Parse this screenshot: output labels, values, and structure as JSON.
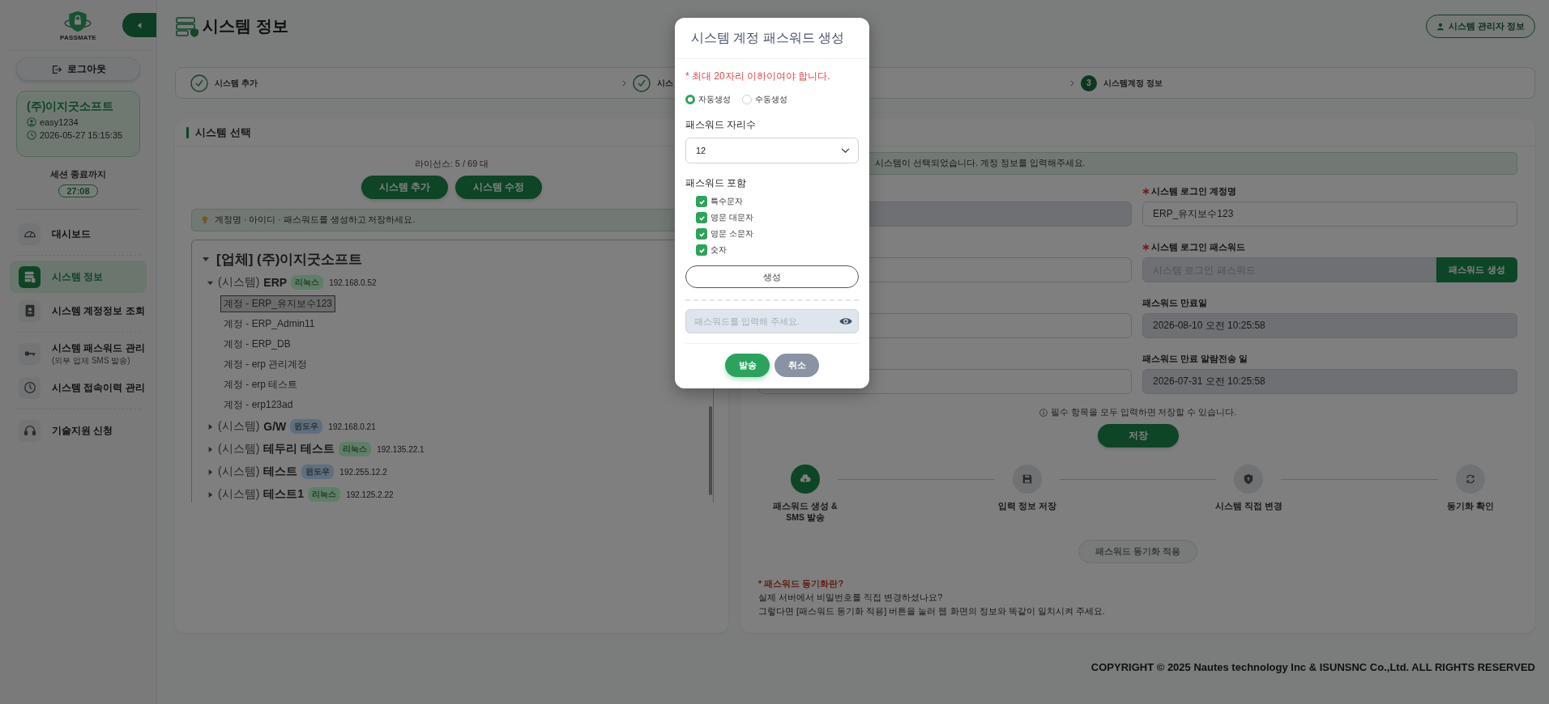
{
  "sidebar": {
    "logo_text": "PASSMATE",
    "logout": "로그아웃",
    "user": {
      "company": "(주)이지굿소프트",
      "id": "easy1234",
      "time": "2026-05-27 15:15:35"
    },
    "session": {
      "label": "세션 종료까지",
      "remaining": "27:08"
    },
    "nav_groups": [
      {
        "items": [
          {
            "label": "대시보드",
            "selected": false
          }
        ]
      },
      {
        "items": [
          {
            "label": "시스템 정보",
            "selected": true
          },
          {
            "label": "시스템 계정정보 조회",
            "selected": false
          }
        ]
      },
      {
        "items": [
          {
            "label": "시스템 패스워드 관리",
            "sub": "(외부 업체 SMS 발송)",
            "selected": false
          },
          {
            "label": "시스템 접속이력 관리",
            "selected": false
          }
        ]
      },
      {
        "items": [
          {
            "label": "기술지원 신청",
            "selected": false
          }
        ]
      }
    ]
  },
  "header": {
    "title": "시스템 정보",
    "admin_button": "시스템 관리자 정보"
  },
  "stepper": [
    {
      "label": "시스템 추가",
      "kind": "done"
    },
    {
      "label": "시스",
      "kind": "done"
    },
    {
      "label": "시스템계정 정보",
      "kind": "current",
      "number": "3"
    }
  ],
  "system_panel": {
    "title": "시스템 선택",
    "license": "라이선스: 5 / 69 대",
    "buttons": [
      "시스템 추가",
      "시스템 수정"
    ],
    "hint": "계정명 · 아이디 · 패스워드를 생성하고 저장하세요.",
    "tree": {
      "label": "[업체] (주)이지굿소프트",
      "expanded": true,
      "children": [
        {
          "prefix": "(시스템)",
          "name": "ERP",
          "tag": {
            "label": "리눅스",
            "color": "#5e7f66"
          },
          "ip": "192.168.0.52",
          "expanded": true,
          "children": [
            {
              "label": "계정 - ERP_유지보수123",
              "selected": true
            },
            {
              "label": "계정 - ERP_Admin11",
              "selected": false
            },
            {
              "label": "계정 - ERP_DB",
              "selected": false
            },
            {
              "label": "계정 - erp 관리계정",
              "selected": false
            },
            {
              "label": "계정 - erp 테스트",
              "selected": false
            },
            {
              "label": "계정 - erp123ad",
              "selected": false
            }
          ]
        },
        {
          "prefix": "(시스템)",
          "name": "G/W",
          "tag": {
            "label": "윈도우",
            "color": "#5e6f7f"
          },
          "ip": "192.168.0.21",
          "expanded": false
        },
        {
          "prefix": "(시스템)",
          "name": "테두리 테스트",
          "tag": {
            "label": "리눅스",
            "color": "#5e7f66"
          },
          "ip": "192.135.22.1",
          "expanded": false
        },
        {
          "prefix": "(시스템)",
          "name": "테스트",
          "tag": {
            "label": "윈도우",
            "color": "#5e6f7f"
          },
          "ip": "192.255.12.2",
          "expanded": false
        },
        {
          "prefix": "(시스템)",
          "name": "테스트1",
          "tag": {
            "label": "리눅스",
            "color": "#5e7f66"
          },
          "ip": "192.125.2.22",
          "expanded": false
        }
      ]
    }
  },
  "account_panel": {
    "hint": "시스템이 선택되었습니다. 계정 정보를 입력해주세요.",
    "left_fields": [
      {
        "disabled": true
      },
      {
        "disabled": false
      },
      {
        "disabled": false
      },
      {
        "disabled": false
      }
    ],
    "fields": [
      {
        "label": "시스템 로그인 계정명",
        "required": true,
        "value": "ERP_유지보수123",
        "disabled": false
      },
      {
        "label": "시스템 로그인 패스워드",
        "required": true,
        "placeholder": "시스템 로그인 패스워드",
        "disabled": true,
        "action": "패스워드 생성"
      },
      {
        "label": "패스워드 만료일",
        "required": false,
        "value": "2026-08-10 오전 10:25:58",
        "disabled": true
      },
      {
        "label": "패스워드 만료 알람전송 일",
        "required": false,
        "value": "2026-07-31 오전 10:25:58",
        "disabled": true
      }
    ],
    "save_note": "필수 항목을 모두 입력하면 저장할 수 있습니다.",
    "save": "저장",
    "flow": [
      {
        "label": "패스워드 생성 & SMS 발송",
        "active": true
      },
      {
        "label": "입력 정보 저장",
        "active": false
      },
      {
        "label": "시스템 직접 변경",
        "active": false
      },
      {
        "label": "동기화 확인",
        "active": false
      }
    ],
    "sync_button": {
      "label": "패스워드 동기화 적용",
      "disabled": true
    },
    "notes": {
      "title": "* 패스워드 동기화란?",
      "lines": [
        "실제 서버에서 비밀번호를 직접 변경하셨나요?",
        "그렇다면 [패스워드 동기화 적용] 버튼을 눌러 웹 화면의 정보와 똑같이 일치시켜 주세요."
      ]
    }
  },
  "footer": "COPYRIGHT © 2025 Nautes technology Inc & ISUNSNC Co.,Ltd. ALL RIGHTS RESERVED",
  "modal": {
    "title": "시스템 계정 패스워드 생성",
    "warning": "* 최대 20자리 이하이여야 합니다.",
    "modes": [
      {
        "label": "자동생성",
        "selected": true
      },
      {
        "label": "수동생성",
        "selected": false
      }
    ],
    "length_label": "패스워드 자리수",
    "length_value": "12",
    "include_label": "패스워드 포함",
    "options": [
      {
        "label": "특수문자",
        "checked": true
      },
      {
        "label": "영문 대문자",
        "checked": true
      },
      {
        "label": "영문 소문자",
        "checked": true
      },
      {
        "label": "숫자",
        "checked": true
      }
    ],
    "generate": "생성",
    "password_placeholder": "패스워드를 입력해 주세요.",
    "send": "발송",
    "cancel": "취소"
  }
}
